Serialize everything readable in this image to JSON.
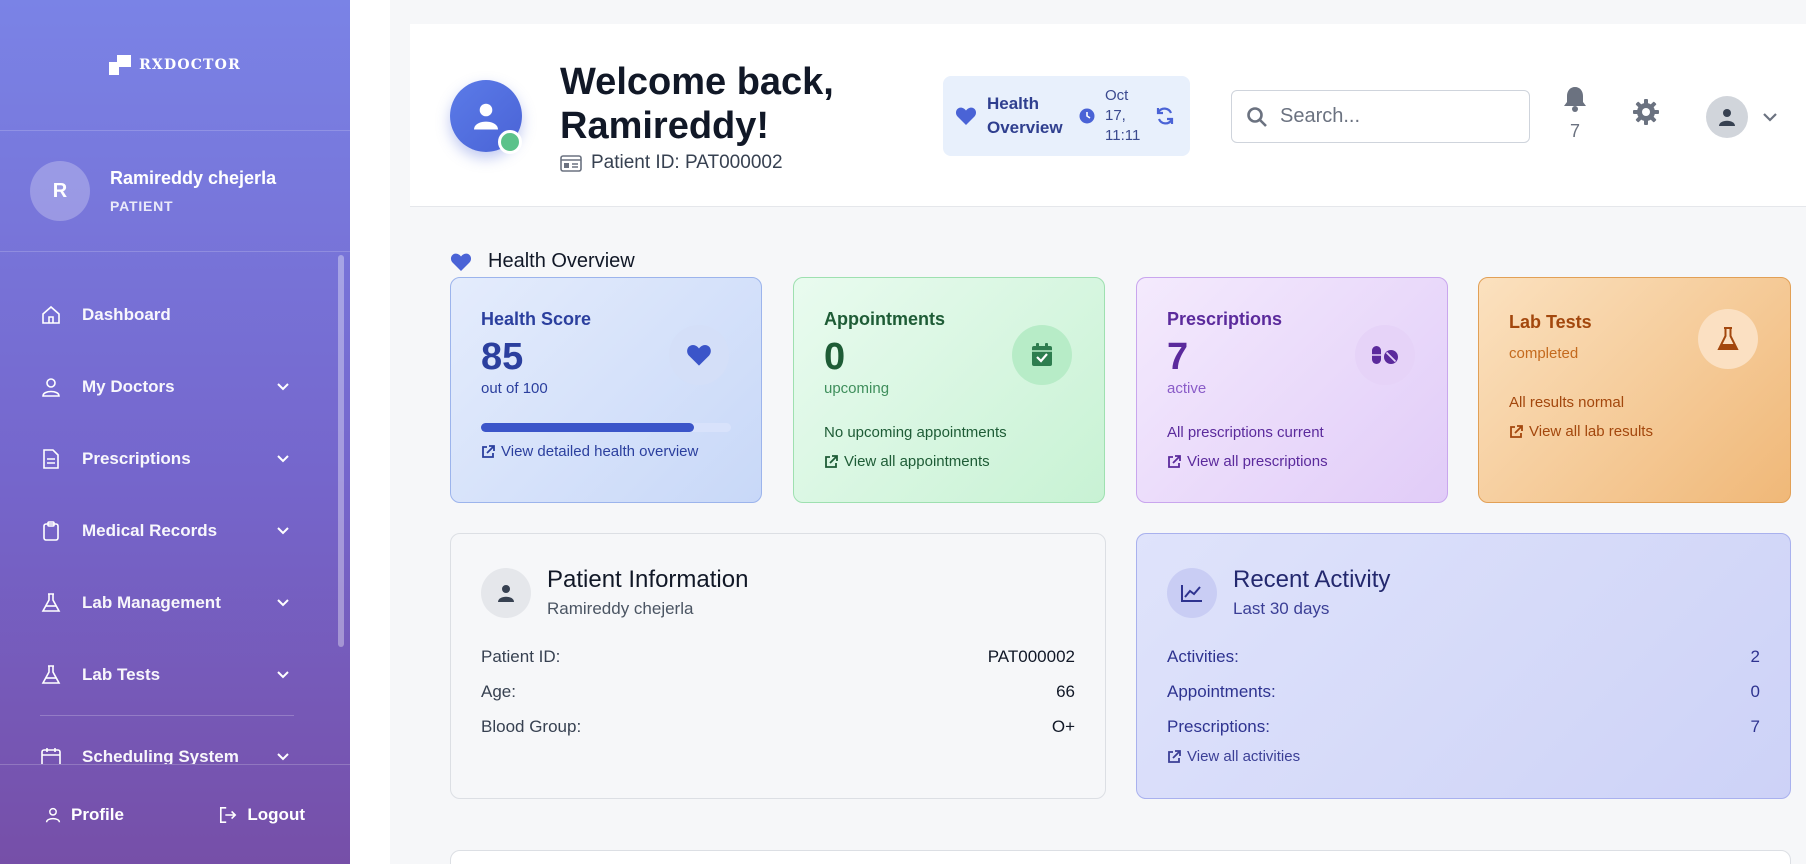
{
  "brand": {
    "name": "RXDOCTOR"
  },
  "user": {
    "initial": "R",
    "name": "Ramireddy chejerla",
    "role": "PATIENT"
  },
  "nav": [
    {
      "label": "Dashboard",
      "icon": "home-icon",
      "has_chevron": false
    },
    {
      "label": "My Doctors",
      "icon": "user-icon",
      "has_chevron": true
    },
    {
      "label": "Prescriptions",
      "icon": "file-icon",
      "has_chevron": true
    },
    {
      "label": "Medical Records",
      "icon": "clipboard-icon",
      "has_chevron": true
    },
    {
      "label": "Lab Management",
      "icon": "flask-icon",
      "has_chevron": true
    },
    {
      "label": "Lab Tests",
      "icon": "flask-icon",
      "has_chevron": true
    },
    {
      "label": "Scheduling System",
      "icon": "calendar-icon",
      "has_chevron": true
    }
  ],
  "footer": {
    "profile": "Profile",
    "logout": "Logout"
  },
  "header": {
    "welcome": "Welcome back, Ramireddy!",
    "patient_id_label": "Patient ID: PAT000002",
    "overview_title": "Health Overview",
    "date": "Oct 17, 11:11",
    "search_placeholder": "Search...",
    "notification_count": "7"
  },
  "section_title": "Health Overview",
  "cards": {
    "health": {
      "title": "Health Score",
      "value": "85",
      "sub": "out of 100",
      "progress": 0.85,
      "link": "View detailed health overview"
    },
    "appointments": {
      "title": "Appointments",
      "value": "0",
      "sub": "upcoming",
      "note": "No upcoming appointments",
      "link": "View all appointments"
    },
    "prescriptions": {
      "title": "Prescriptions",
      "value": "7",
      "sub": "active",
      "note": "All prescriptions current",
      "link": "View all prescriptions"
    },
    "lab": {
      "title": "Lab Tests",
      "sub": "completed",
      "note": "All results normal",
      "link": "View all lab results"
    }
  },
  "patient_info": {
    "title": "Patient Information",
    "subtitle": "Ramireddy chejerla",
    "rows": [
      {
        "k": "Patient ID:",
        "v": "PAT000002"
      },
      {
        "k": "Age:",
        "v": "66"
      },
      {
        "k": "Blood Group:",
        "v": "O+"
      }
    ]
  },
  "recent_activity": {
    "title": "Recent Activity",
    "subtitle": "Last 30 days",
    "rows": [
      {
        "k": "Activities:",
        "v": "2"
      },
      {
        "k": "Appointments:",
        "v": "0"
      },
      {
        "k": "Prescriptions:",
        "v": "7"
      }
    ],
    "link": "View all activities"
  },
  "colors": {
    "sidebar_top": "#7a83e6",
    "sidebar_bottom": "#764fa8",
    "accent": "#4a63d6",
    "online": "#5cc28a"
  }
}
